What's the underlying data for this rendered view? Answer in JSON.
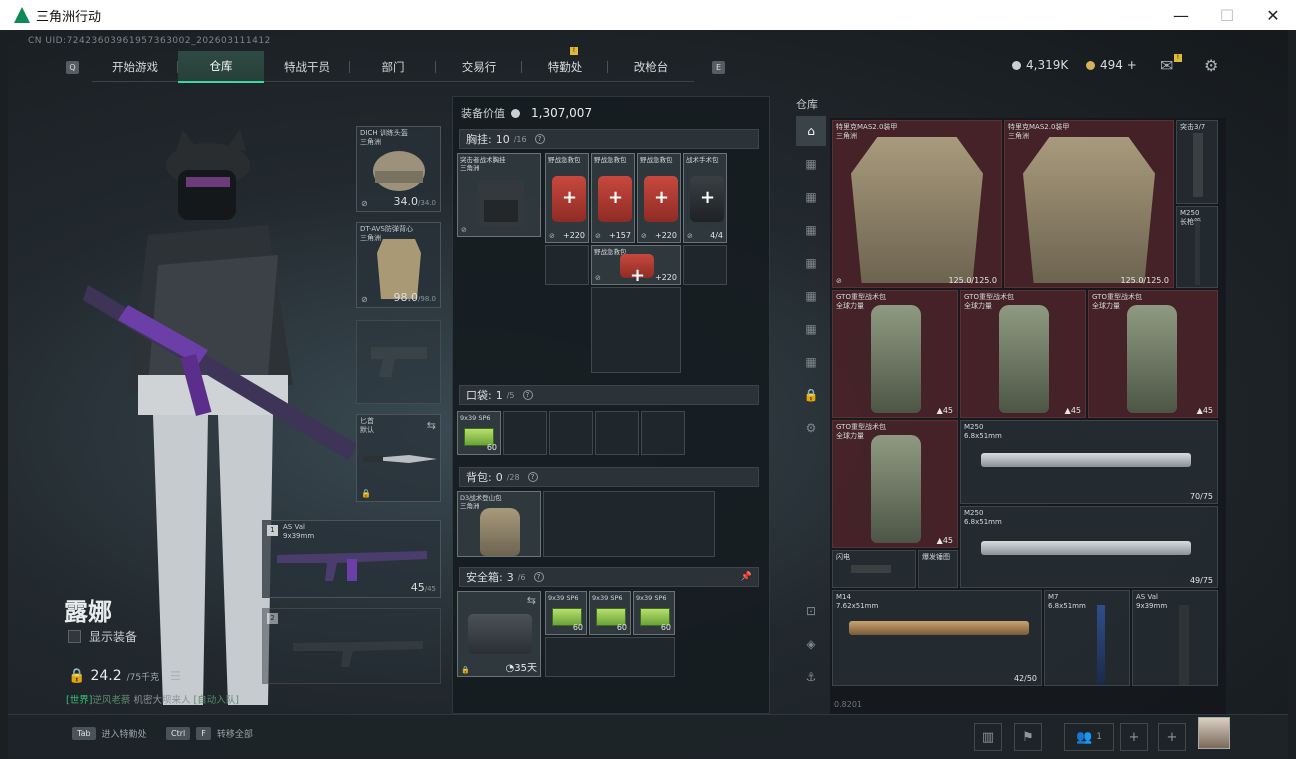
{
  "window": {
    "title": "三角洲行动",
    "controls": [
      "—",
      "☐",
      "✕"
    ]
  },
  "uid": "CN UID:72423603961957363002_202603111412",
  "nav": {
    "key_left": "Q",
    "key_right": "E",
    "tabs": [
      {
        "label": "开始游戏"
      },
      {
        "label": "仓库",
        "active": true
      },
      {
        "label": "特战干员"
      },
      {
        "label": "部门"
      },
      {
        "label": "交易行"
      },
      {
        "label": "特勤处",
        "badge": "!"
      },
      {
        "label": "改枪台"
      }
    ]
  },
  "currency": {
    "silver": "4,319K",
    "gold": "494",
    "gold_plus": "+"
  },
  "mail_badge": "!",
  "character": {
    "name": "露娜",
    "show_equipment": "显示装备",
    "weight": "24.2",
    "weight_max": "/75千克",
    "world_chat": {
      "channel": "[世界]",
      "user": "逆风老蔡",
      "msg": "机密大坝来人",
      "tag": "[自动入队]"
    }
  },
  "equip_slots": {
    "helmet": {
      "name": "DICH 训练头盔",
      "sub": "三角洲",
      "durability": "34.0",
      "max": "/34.0"
    },
    "armor": {
      "name": "DT-AVS防弹背心",
      "sub": "三角洲",
      "durability": "98.0",
      "max": "/98.0"
    },
    "melee": {
      "name": "匕首",
      "sub": "默认"
    },
    "primary": {
      "slot": "1",
      "name": "AS Val",
      "ammo": "9x39mm",
      "count": "45",
      "max": "/45"
    },
    "secondary": {
      "slot": "2"
    }
  },
  "middle": {
    "equip_value_label": "装备价值",
    "equip_value": "1,307,007",
    "chest": {
      "label": "胸挂:",
      "count": "10",
      "max": "/16",
      "rig_name": "突击者战术胸挂",
      "rig_sub": "三角洲",
      "items": [
        {
          "name": "野战急救包",
          "count": "220"
        },
        {
          "name": "野战急救包",
          "count": "157"
        },
        {
          "name": "野战急救包",
          "count": "220"
        },
        {
          "name": "战术手术包",
          "count": "4/4"
        },
        {
          "name": "野战急救包",
          "count": "220"
        }
      ]
    },
    "pocket": {
      "label": "口袋:",
      "count": "1",
      "max": "/5",
      "item_name": "9x39 SP6",
      "item_count": "60"
    },
    "backpack": {
      "label": "背包:",
      "count": "0",
      "max": "/28",
      "bag_name": "D3战术登山包",
      "bag_sub": "三角洲"
    },
    "safe": {
      "label": "安全箱:",
      "count": "3",
      "max": "/6",
      "days": "35天",
      "items": [
        {
          "name": "9x39 SP6",
          "count": "60"
        },
        {
          "name": "9x39 SP6",
          "count": "60"
        },
        {
          "name": "9x39 SP6",
          "count": "60"
        }
      ]
    }
  },
  "storage": {
    "label": "仓库",
    "items": [
      {
        "name": "特里克MAS2.0装甲",
        "sub": "三角洲",
        "dur": "125.0/125.0"
      },
      {
        "name": "特里克MAS2.0装甲",
        "sub": "三角洲",
        "dur": "125.0/125.0"
      },
      {
        "name": "突击3/7",
        "sub": ""
      },
      {
        "name": "M250",
        "sub": "长枪管"
      },
      {
        "name": "GTO重型战术包",
        "sub": "全球力量",
        "count": "45"
      },
      {
        "name": "GTO重型战术包",
        "sub": "全球力量",
        "count": "45"
      },
      {
        "name": "GTO重型战术包",
        "sub": "全球力量",
        "count": "45"
      },
      {
        "name": "GTO重型战术包",
        "sub": "全球力量",
        "count": "45"
      },
      {
        "name": "M250",
        "sub": "6.8x51mm",
        "count": "70/75"
      },
      {
        "name": "M250",
        "sub": "6.8x51mm",
        "count": "49/75"
      },
      {
        "name": "闪电",
        "sub": ""
      },
      {
        "name": "爆发锤图",
        "sub": ""
      },
      {
        "name": "M14",
        "sub": "7.62x51mm",
        "count": "42/50"
      },
      {
        "name": "M7",
        "sub": "6.8x51mm"
      },
      {
        "name": "AS Val",
        "sub": "9x39mm"
      }
    ],
    "footer": "0.8201"
  },
  "bottom": {
    "hint1_key": "Tab",
    "hint1": "进入特勤处",
    "hint2_key1": "Ctrl",
    "hint2_key2": "F",
    "hint2": "转移全部",
    "squad_count": "1"
  }
}
